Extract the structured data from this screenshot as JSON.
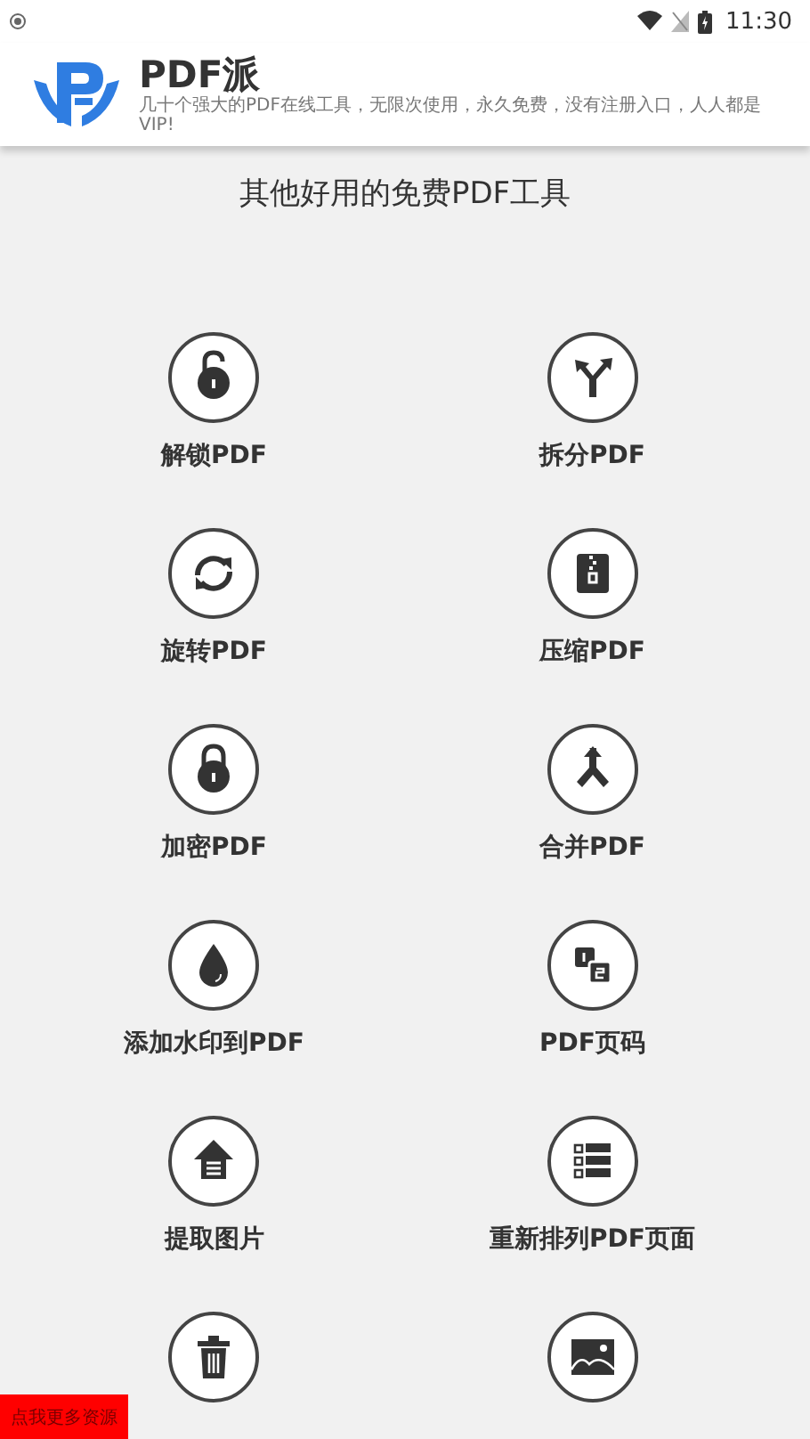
{
  "status_bar": {
    "time": "11:30"
  },
  "header": {
    "title": "PDF派",
    "subtitle": "几十个强大的PDF在线工具，无限次使用，永久免费，没有注册入口，人人都是VIP!"
  },
  "section_title": "其他好用的免费PDF工具",
  "tools": [
    {
      "kind": "unlock",
      "label": "解锁PDF"
    },
    {
      "kind": "split",
      "label": "拆分PDF"
    },
    {
      "kind": "rotate",
      "label": "旋转PDF"
    },
    {
      "kind": "compress",
      "label": "压缩PDF"
    },
    {
      "kind": "lock",
      "label": "加密PDF"
    },
    {
      "kind": "merge",
      "label": "合并PDF"
    },
    {
      "kind": "watermark",
      "label": "添加水印到PDF"
    },
    {
      "kind": "pagenum",
      "label": "PDF页码"
    },
    {
      "kind": "extract",
      "label": "提取图片"
    },
    {
      "kind": "reorder",
      "label": "重新排列PDF页面"
    },
    {
      "kind": "delete"
    },
    {
      "kind": "image"
    }
  ],
  "promo_button": "点我更多资源"
}
